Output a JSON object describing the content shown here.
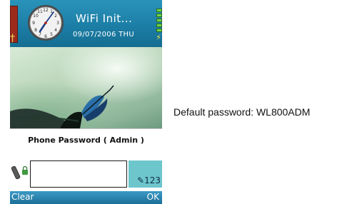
{
  "status_bar": {
    "title": "WiFi Init...",
    "date": "09/07/2006 THU",
    "clock_icon": "analog-clock-icon",
    "signal_icon": "signal-tower-icon",
    "battery_icon": "battery-icon"
  },
  "dialog": {
    "title": "Phone Password ( Admin )",
    "input_value": "",
    "input_mode": "123",
    "input_mode_icon": "pen-icon",
    "phone_icon": "phone-lock-icon"
  },
  "softkeys": {
    "left": "Clear",
    "right": "OK"
  },
  "caption": "Default password: WL800ADM",
  "colors": {
    "status_bar": "#1c7ea6",
    "softkey_bar": "#2a86b2",
    "input_mode_bg": "#6ec6cd",
    "signal_red": "#9c2b1c",
    "battery_green": "#6fd44b"
  }
}
